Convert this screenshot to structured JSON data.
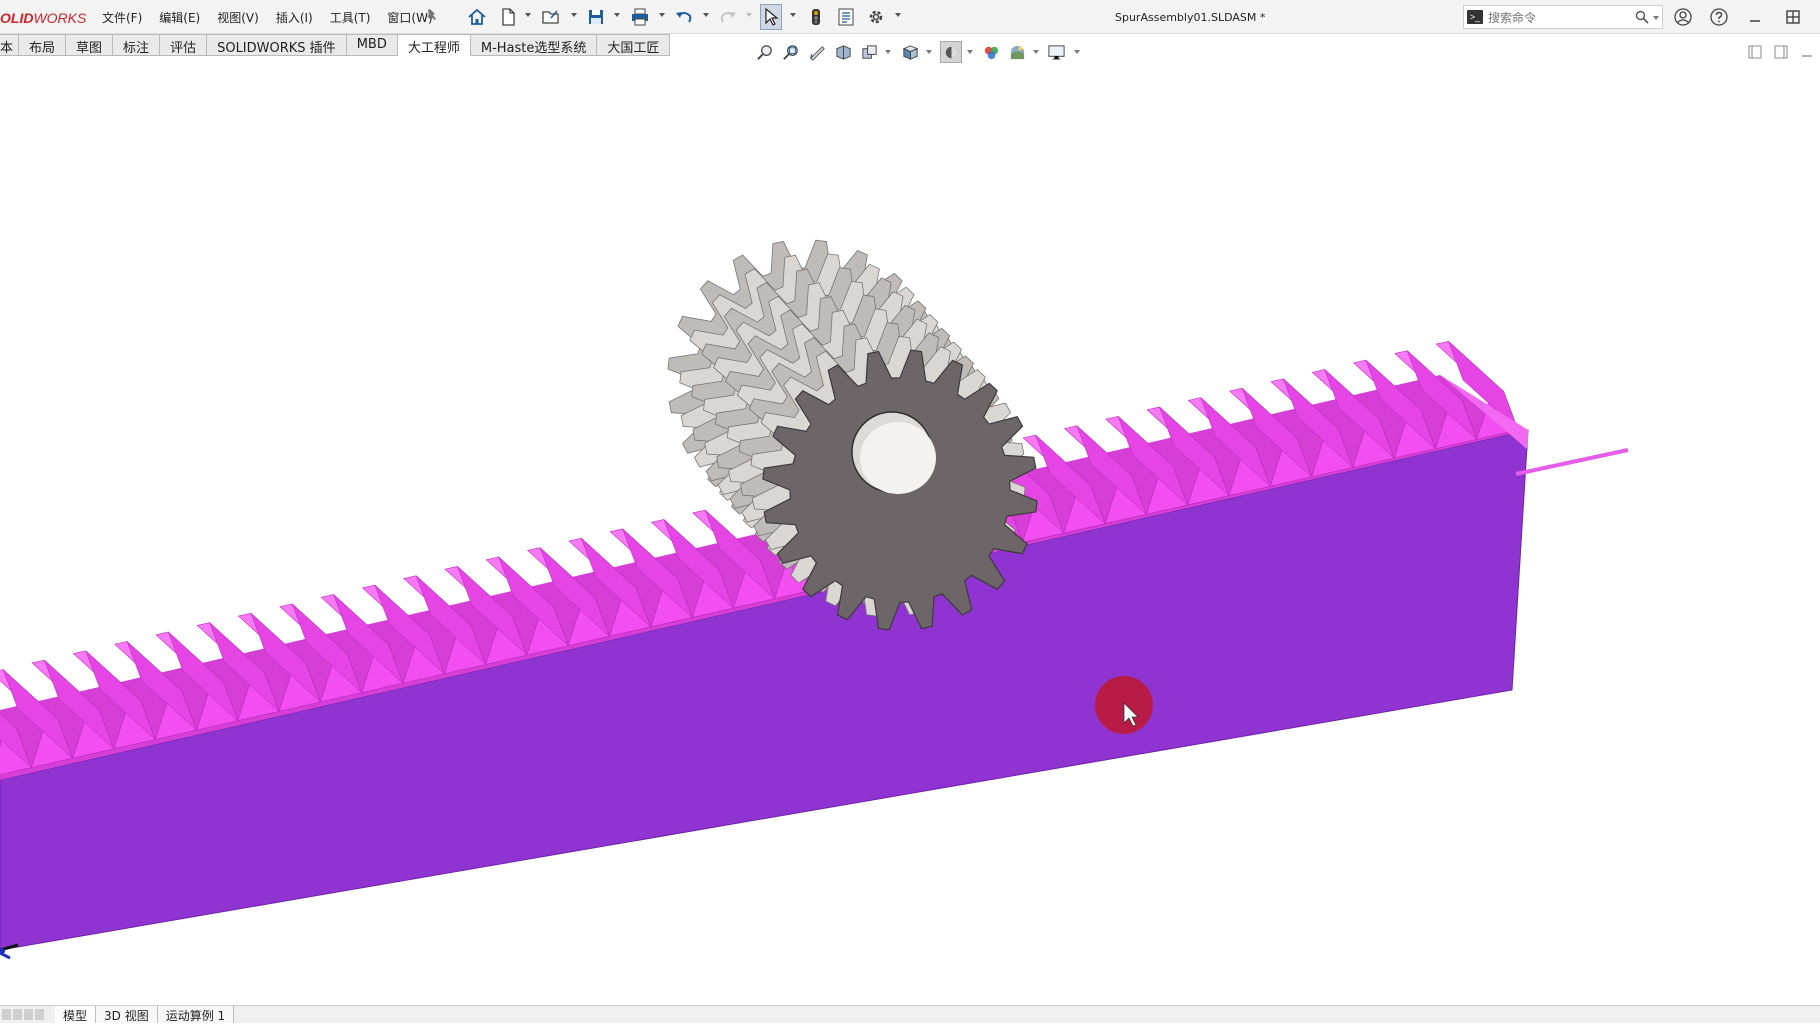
{
  "app": {
    "logo_bold": "OLID",
    "logo_italic": "WORKS"
  },
  "menus": [
    "文件(F)",
    "编辑(E)",
    "视图(V)",
    "插入(I)",
    "工具(T)",
    "窗口(W)"
  ],
  "document": {
    "title": "SpurAssembly01.SLDASM *"
  },
  "search": {
    "placeholder": "搜索命令"
  },
  "tabs": [
    "本",
    "布局",
    "草图",
    "标注",
    "评估",
    "SOLIDWORKS 插件",
    "MBD",
    "大工程师",
    "M-Haste选型系统",
    "大国工匠"
  ],
  "active_tab": "大工程师",
  "bottom_tabs": [
    "模型",
    "3D 视图",
    "运动算例 1"
  ],
  "active_bottom_tab": "模型",
  "colors": {
    "rack_side": "#8f34d1",
    "rack_teeth": "#f34ef2",
    "gear_face": "#6d6668",
    "gear_teeth": "#d9d6d4",
    "cursor_marker": "#c0192e"
  }
}
